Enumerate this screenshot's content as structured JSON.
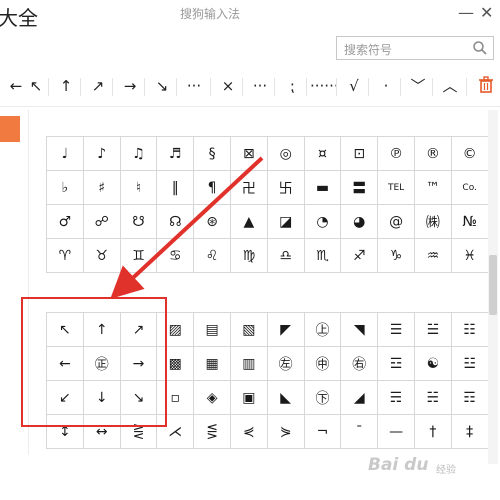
{
  "window": {
    "title_partial": "大全",
    "app_title": "搜狗输入法",
    "minimize_glyph": "—",
    "close_glyph": "✕"
  },
  "search": {
    "placeholder": "搜索符号"
  },
  "toolbar": {
    "items": [
      "←",
      "↖",
      "↑",
      "↗",
      "→",
      "↘",
      "···",
      "×",
      "···",
      "⁏",
      "······",
      "√",
      "·",
      "﹀",
      "︿"
    ]
  },
  "table1": [
    [
      "♩",
      "♪",
      "♫",
      "♬",
      "§",
      "⊠",
      "◎",
      "¤",
      "⊡",
      "℗",
      "®",
      "©"
    ],
    [
      "♭",
      "♯",
      "♮",
      "‖",
      "¶",
      "卍",
      "卐",
      "▬",
      "〓",
      "TEL",
      "™",
      "Co."
    ],
    [
      "♂",
      "☍",
      "☋",
      "☊",
      "⊛",
      "▲",
      "◪",
      "◔",
      "◕",
      "@",
      "㈱",
      "№"
    ],
    [
      "♈",
      "♉",
      "♊",
      "♋",
      "♌",
      "♍",
      "♎",
      "♏",
      "♐",
      "♑",
      "♒",
      "♓"
    ]
  ],
  "table2": [
    [
      "↖",
      "↑",
      "↗",
      "▨",
      "▤",
      "▧",
      "◤",
      "㊤",
      "◥",
      "☰",
      "☱",
      "☷"
    ],
    [
      "←",
      "㊣",
      "→",
      "▩",
      "▦",
      "▥",
      "㊧",
      "㊥",
      "㊨",
      "☲",
      "☯",
      "☳"
    ],
    [
      "↙",
      "↓",
      "↘",
      "▫",
      "◈",
      "▣",
      "◣",
      "㊦",
      "◢",
      "☴",
      "☵",
      "☶"
    ],
    [
      "↕",
      "↔",
      "⋛",
      "⋌",
      "⋚",
      "⋞",
      "⋟",
      "¬",
      "¯",
      "—",
      "†",
      "‡"
    ]
  ],
  "watermark": {
    "text": "Bai du",
    "sub": "经验"
  }
}
